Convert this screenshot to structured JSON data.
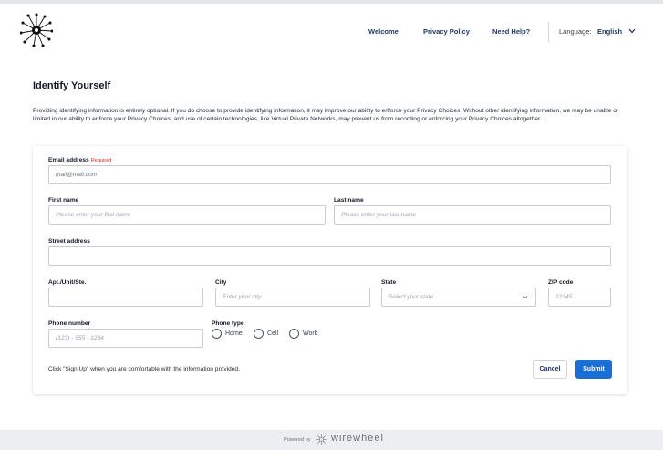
{
  "header": {
    "logo": "starburst-logo-icon",
    "nav": [
      "Welcome",
      "Privacy Policy",
      "Need Help?"
    ],
    "language_label": "Language:",
    "language_value": "English"
  },
  "page": {
    "title": "Identify Yourself",
    "intro": "Providing identifying information is entirely optional. If you do choose to provide identifying information, it may improve our ability to enforce your Privacy Choices. Without other identifying information, we may be unable or limited in our ability to enforce your Privacy Choices, and use of certain technologies, like Virtual Private Networks, may prevent us from recording or enforcing your Privacy Choices altogether."
  },
  "form": {
    "email": {
      "label": "Email address",
      "required": "Required",
      "value": "mail@mail.com"
    },
    "first_name": {
      "label": "First name",
      "placeholder": "Please enter your first name"
    },
    "last_name": {
      "label": "Last name",
      "placeholder": "Please enter your last name"
    },
    "street": {
      "label": "Street address",
      "placeholder": ""
    },
    "apt": {
      "label": "Apt./Unit/Ste.",
      "placeholder": ""
    },
    "city": {
      "label": "City",
      "placeholder": "Enter your city"
    },
    "state": {
      "label": "State",
      "placeholder": "Select your state"
    },
    "zip": {
      "label": "ZIP code",
      "placeholder": "12345"
    },
    "phone": {
      "label": "Phone number",
      "placeholder": "(123) - 555 - 1234"
    },
    "phone_type": {
      "label": "Phone type",
      "options": [
        "Home",
        "Cell",
        "Work"
      ]
    },
    "note": "Click \"Sign Up\" when you are comfortable with the information provided.",
    "cancel_label": "Cancel",
    "submit_label": "Submit"
  },
  "footer": {
    "powered_by": "Powered by",
    "brand": "wirewheel"
  },
  "colors": {
    "primary": "#1a6fd4",
    "nav_text": "#1f3a68",
    "required": "#dc2626"
  }
}
